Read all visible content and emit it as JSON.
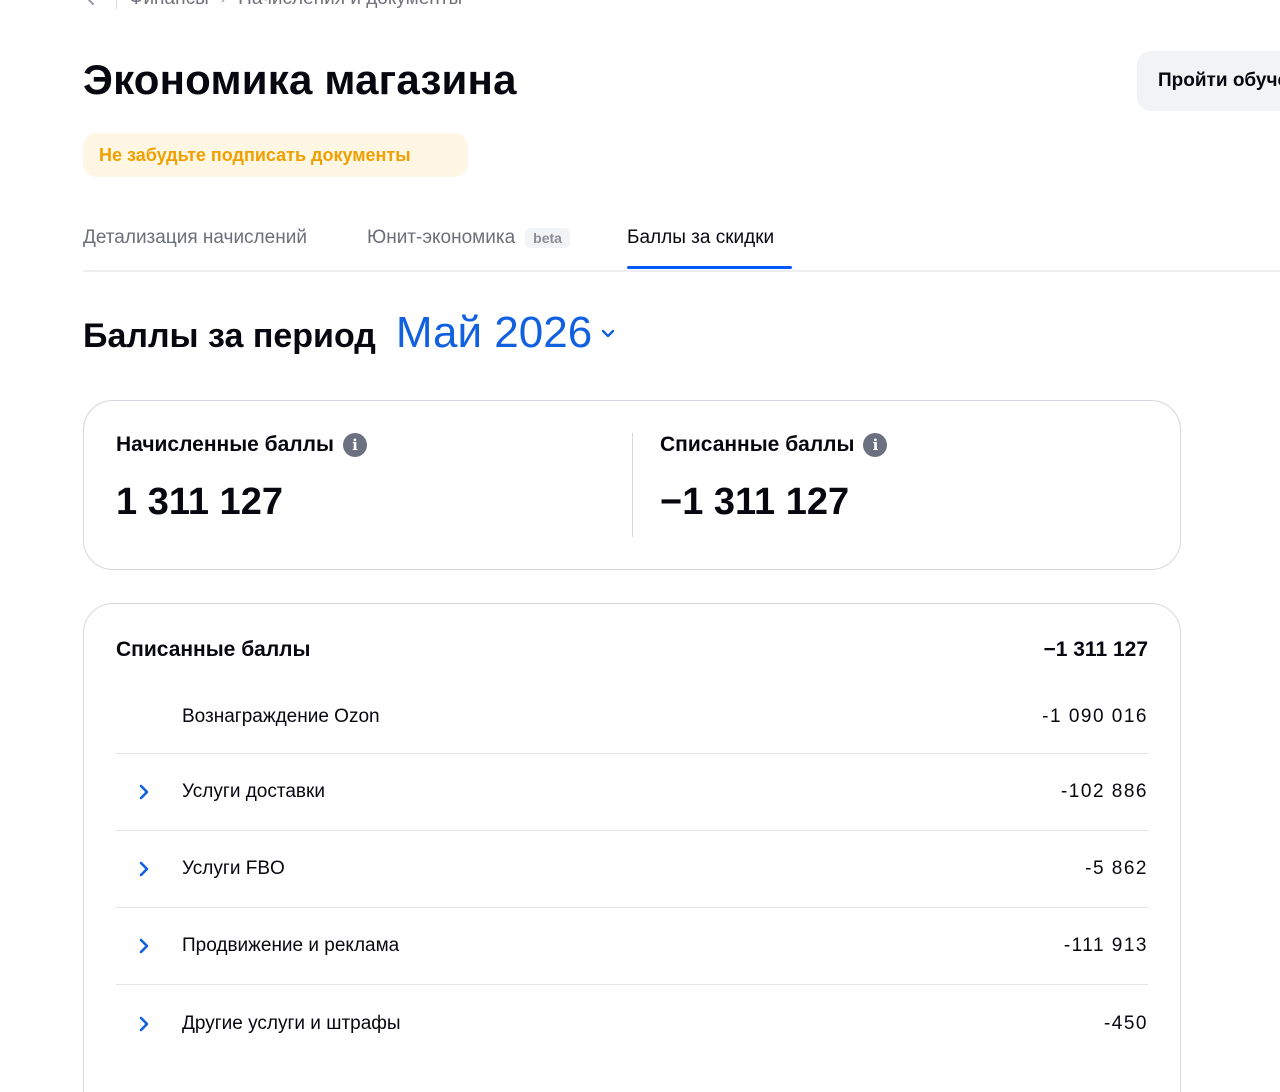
{
  "breadcrumb": {
    "items": [
      "Финансы",
      "Начисления и документы"
    ]
  },
  "header": {
    "title": "Экономика магазина",
    "help_button_label": "Пройти обучение"
  },
  "notice": {
    "text": "Не забудьте подписать документы",
    "color": "#f0a000"
  },
  "tabs": [
    {
      "label": "Детализация начислений",
      "active": false
    },
    {
      "label": "Юнит-экономика",
      "badge": "beta",
      "active": false
    },
    {
      "label": "Баллы за скидки",
      "active": true
    }
  ],
  "period": {
    "label": "Баллы за период",
    "selected": "Май 2026",
    "accent_color": "#1060e0"
  },
  "summary": {
    "accrued": {
      "label": "Начисленные баллы",
      "value": "1 311 127"
    },
    "written_off": {
      "label": "Списанные баллы",
      "value": "−1 311 127"
    }
  },
  "details": {
    "title": "Списанные баллы",
    "total": "−1 311 127",
    "rows": [
      {
        "label": "Вознаграждение Ozon",
        "value": "-1 090 016",
        "expandable": false
      },
      {
        "label": "Услуги доставки",
        "value": "-102 886",
        "expandable": true
      },
      {
        "label": "Услуги FBO",
        "value": "-5 862",
        "expandable": true
      },
      {
        "label": "Продвижение и реклама",
        "value": "-111 913",
        "expandable": true
      },
      {
        "label": "Другие услуги и штрафы",
        "value": "-450",
        "expandable": true
      }
    ]
  },
  "icons": {
    "back": "arrow-left-icon",
    "info": "info-icon",
    "expand": "chevron-right-icon",
    "dropdown": "chevron-down-icon"
  }
}
